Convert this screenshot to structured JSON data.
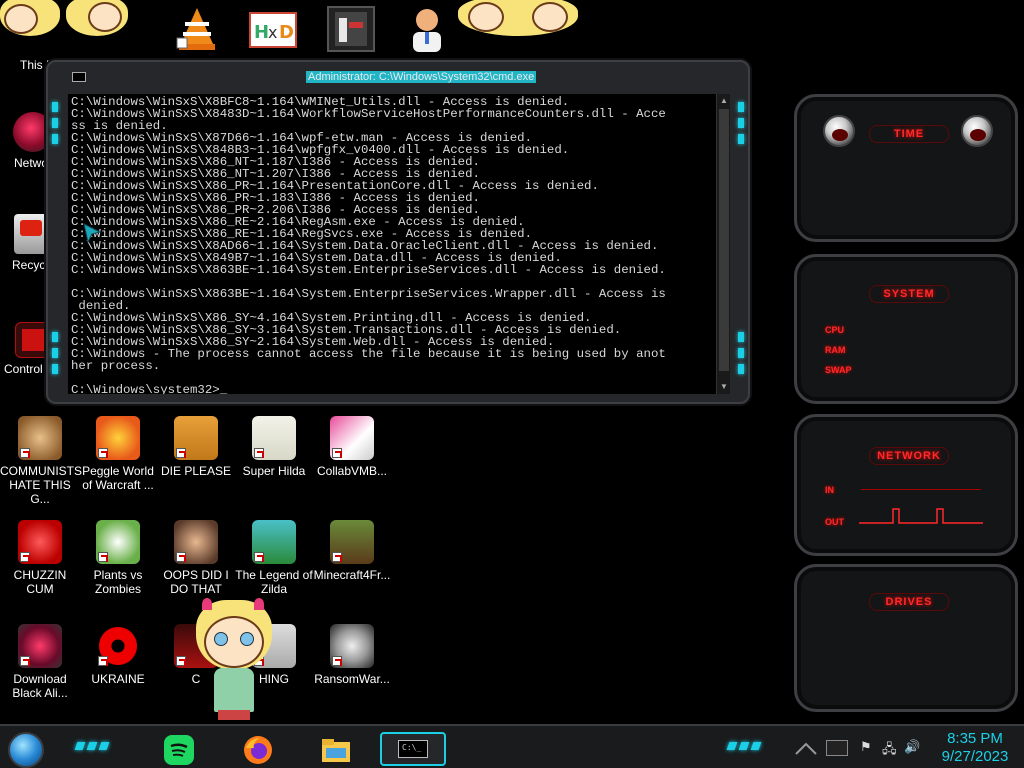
{
  "desktop": {
    "partial_labels": {
      "this_pc": "This PC",
      "network": "Netwo",
      "recycle": "Recycle",
      "control": "Control"
    },
    "icons": [
      {
        "label": "COMMUNISTS HATE THIS G..."
      },
      {
        "label": "Peggle World of Warcraft ..."
      },
      {
        "label": "DIE PLEASE"
      },
      {
        "label": "Super Hilda"
      },
      {
        "label": "CollabVMB..."
      },
      {
        "label": "CHUZZIN CUM"
      },
      {
        "label": "Plants vs Zombies"
      },
      {
        "label": "OOPS DID I DO THAT"
      },
      {
        "label": "The Legend of Zilda"
      },
      {
        "label": "Minecraft4Fr..."
      },
      {
        "label": "Download Black Ali..."
      },
      {
        "label": "UKRAINE"
      },
      {
        "label": "C"
      },
      {
        "label": "HING"
      },
      {
        "label": "RansomWar..."
      }
    ]
  },
  "cmd_window": {
    "title": "Administrator: C:\\Windows\\System32\\cmd.exe",
    "lines": [
      "C:\\Windows\\WinSxS\\X8BFC8~1.164\\WMINet_Utils.dll - Access is denied.",
      "C:\\Windows\\WinSxS\\X8483D~1.164\\WorkflowServiceHostPerformanceCounters.dll - Acce",
      "ss is denied.",
      "C:\\Windows\\WinSxS\\X87D66~1.164\\wpf-etw.man - Access is denied.",
      "C:\\Windows\\WinSxS\\X848B3~1.164\\wpfgfx_v0400.dll - Access is denied.",
      "C:\\Windows\\WinSxS\\X86_NT~1.187\\I386 - Access is denied.",
      "C:\\Windows\\WinSxS\\X86_NT~1.207\\I386 - Access is denied.",
      "C:\\Windows\\WinSxS\\X86_PR~1.164\\PresentationCore.dll - Access is denied.",
      "C:\\Windows\\WinSxS\\X86_PR~1.183\\I386 - Access is denied.",
      "C:\\Windows\\WinSxS\\X86_PR~2.206\\I386 - Access is denied.",
      "C:\\Windows\\WinSxS\\X86_RE~2.164\\RegAsm.exe - Access is denied.",
      "C:\\Windows\\WinSxS\\X86_RE~1.164\\RegSvcs.exe - Access is denied.",
      "C:\\Windows\\WinSxS\\X8AD66~1.164\\System.Data.OracleClient.dll - Access is denied.",
      "C:\\Windows\\WinSxS\\X849B7~1.164\\System.Data.dll - Access is denied.",
      "C:\\Windows\\WinSxS\\X863BE~1.164\\System.EnterpriseServices.dll - Access is denied.",
      "",
      "C:\\Windows\\WinSxS\\X863BE~1.164\\System.EnterpriseServices.Wrapper.dll - Access is",
      " denied.",
      "C:\\Windows\\WinSxS\\X86_SY~4.164\\System.Printing.dll - Access is denied.",
      "C:\\Windows\\WinSxS\\X86_SY~3.164\\System.Transactions.dll - Access is denied.",
      "C:\\Windows\\WinSxS\\X86_SY~2.164\\System.Web.dll - Access is denied.",
      "C:\\Windows - The process cannot access the file because it is being used by anot",
      "her process.",
      "",
      "C:\\Windows\\system32>_"
    ]
  },
  "gadgets": {
    "time": {
      "title": "TIME"
    },
    "system": {
      "title": "SYSTEM",
      "labels": [
        "CPU",
        "RAM",
        "SWAP"
      ]
    },
    "network": {
      "title": "NETWORK",
      "labels": [
        "IN",
        "OUT"
      ]
    },
    "drives": {
      "title": "DRIVES"
    }
  },
  "taskbar": {
    "time": "8:35 PM",
    "date": "9/27/2023"
  },
  "colors": {
    "accent": "#1bd0e6",
    "gadget_red": "#ff2a2a",
    "console_bg": "#000000",
    "console_fg": "#d9d9d9"
  }
}
